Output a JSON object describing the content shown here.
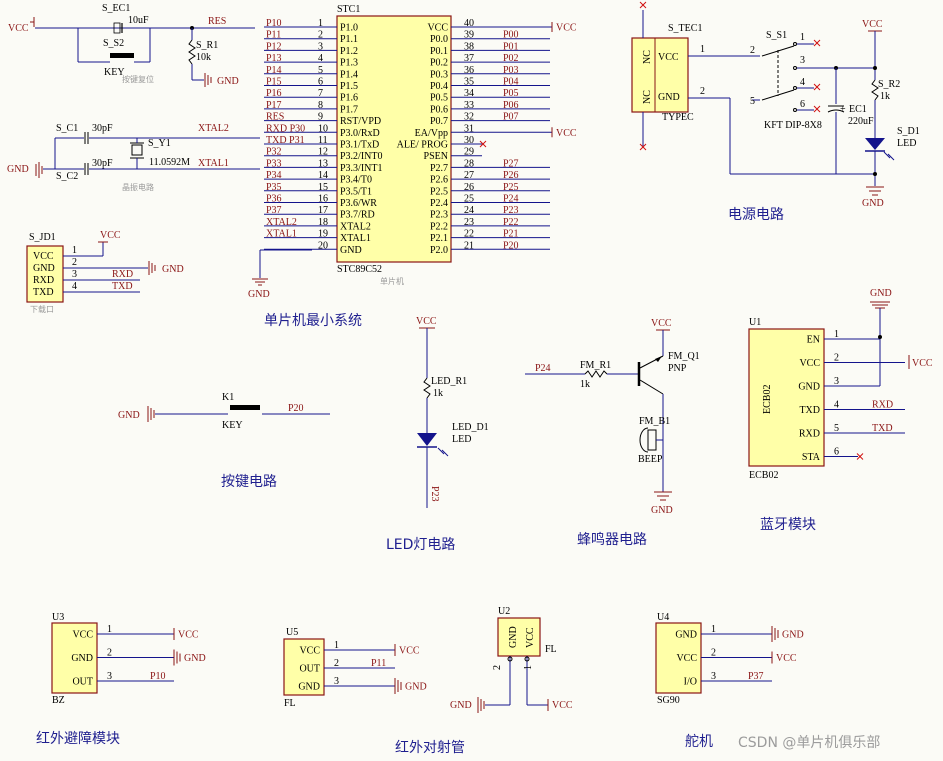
{
  "sections": {
    "mcu_title": "单片机最小系统",
    "power_title": "电源电路",
    "button_title": "按键电路",
    "led_title": "LED灯电路",
    "buzzer_title": "蜂鸣器电路",
    "bluetooth_title": "蓝牙模块",
    "ir_obstacle_title": "红外避障模块",
    "ir_beam_title": "红外对射管",
    "servo_title": "舵机"
  },
  "mcu": {
    "designator": "STC1",
    "part": "STC89C52",
    "caption": "单片机",
    "left_pins": [
      {
        "n": "1",
        "name": "P1.0",
        "net": "P10"
      },
      {
        "n": "2",
        "name": "P1.1",
        "net": "P11"
      },
      {
        "n": "3",
        "name": "P1.2",
        "net": "P12"
      },
      {
        "n": "4",
        "name": "P1.3",
        "net": "P13"
      },
      {
        "n": "5",
        "name": "P1.4",
        "net": "P14"
      },
      {
        "n": "6",
        "name": "P1.5",
        "net": "P15"
      },
      {
        "n": "7",
        "name": "P1.6",
        "net": "P16"
      },
      {
        "n": "8",
        "name": "P1.7",
        "net": "P17"
      },
      {
        "n": "9",
        "name": "RST/VPD",
        "net": "RES"
      },
      {
        "n": "10",
        "name": "P3.0/RxD",
        "net": "RXD P30"
      },
      {
        "n": "11",
        "name": "P3.1/TxD",
        "net": "TXD P31"
      },
      {
        "n": "12",
        "name": "P3.2/INT0",
        "net": "P32"
      },
      {
        "n": "13",
        "name": "P3.3/INT1",
        "net": "P33"
      },
      {
        "n": "14",
        "name": "P3.4/T0",
        "net": "P34"
      },
      {
        "n": "15",
        "name": "P3.5/T1",
        "net": "P35"
      },
      {
        "n": "16",
        "name": "P3.6/WR",
        "net": "P36"
      },
      {
        "n": "17",
        "name": "P3.7/RD",
        "net": "P37"
      },
      {
        "n": "18",
        "name": "XTAL2",
        "net": "XTAL2"
      },
      {
        "n": "19",
        "name": "XTAL1",
        "net": "XTAL1"
      },
      {
        "n": "20",
        "name": "GND",
        "net": ""
      }
    ],
    "right_pins": [
      {
        "n": "40",
        "name": "VCC",
        "net": "VCC"
      },
      {
        "n": "39",
        "name": "P0.0",
        "net": "P00"
      },
      {
        "n": "38",
        "name": "P0.1",
        "net": "P01"
      },
      {
        "n": "37",
        "name": "P0.2",
        "net": "P02"
      },
      {
        "n": "36",
        "name": "P0.3",
        "net": "P03"
      },
      {
        "n": "35",
        "name": "P0.4",
        "net": "P04"
      },
      {
        "n": "34",
        "name": "P0.5",
        "net": "P05"
      },
      {
        "n": "33",
        "name": "P0.6",
        "net": "P06"
      },
      {
        "n": "32",
        "name": "P0.7",
        "net": "P07"
      },
      {
        "n": "31",
        "name": "EA/Vpp",
        "net": "VCC"
      },
      {
        "n": "30",
        "name": "ALE/ PROG",
        "net": ""
      },
      {
        "n": "29",
        "name": "PSEN",
        "net": ""
      },
      {
        "n": "28",
        "name": "P2.7",
        "net": "P27"
      },
      {
        "n": "27",
        "name": "P2.6",
        "net": "P26"
      },
      {
        "n": "26",
        "name": "P2.5",
        "net": "P25"
      },
      {
        "n": "25",
        "name": "P2.4",
        "net": "P24"
      },
      {
        "n": "24",
        "name": "P2.3",
        "net": "P23"
      },
      {
        "n": "23",
        "name": "P2.2",
        "net": "P22"
      },
      {
        "n": "22",
        "name": "P2.1",
        "net": "P21"
      },
      {
        "n": "21",
        "name": "P2.0",
        "net": "P20"
      }
    ],
    "gnd": "GND"
  },
  "reset": {
    "vcc": "VCC",
    "cap": "S_EC1",
    "cap_value": "10uF",
    "switch": "S_S2",
    "switch_label": "KEY",
    "res": "S_R1",
    "res_value": "10k",
    "net": "RES",
    "gnd": "GND",
    "caption": "按键复位"
  },
  "crystal": {
    "c1": "S_C1",
    "c1_value": "30pF",
    "c2": "S_C2",
    "c2_value": "30pF",
    "xtal": "S_Y1",
    "freq": "11.0592M",
    "xtal2": "XTAL2",
    "xtal1": "XTAL1",
    "gnd": "GND",
    "caption": "晶振电路"
  },
  "download": {
    "designator": "S_JD1",
    "pins": [
      "VCC",
      "GND",
      "RXD",
      "TXD"
    ],
    "nums": [
      "1",
      "2",
      "3",
      "4"
    ],
    "vcc": "VCC",
    "gnd": "GND",
    "rxd": "RXD",
    "txd": "TXD",
    "caption": "下载口"
  },
  "power": {
    "jack": "S_TEC1",
    "jack_type": "TYPEC",
    "pin_vcc": "VCC",
    "pin_gnd": "GND",
    "nc": "NC",
    "pin1": "1",
    "pin2": "2",
    "switch": "S_S1",
    "switch_pins": [
      "1",
      "2",
      "3",
      "4",
      "5",
      "6"
    ],
    "switch_part": "KFT DIP-8X8",
    "cap": "EC1",
    "cap_value": "220uF",
    "res": "S_R2",
    "res_value": "1k",
    "led": "S_D1",
    "led_label": "LED",
    "vcc": "VCC",
    "gnd": "GND"
  },
  "button": {
    "gnd": "GND",
    "designator": "K1",
    "label": "KEY",
    "net": "P20"
  },
  "led": {
    "vcc": "VCC",
    "res": "LED_R1",
    "res_value": "1k",
    "led": "LED_D1",
    "led_label": "LED",
    "net": "P23"
  },
  "buzzer": {
    "vcc": "VCC",
    "net": "P24",
    "res": "FM_R1",
    "res_value": "1k",
    "transistor": "FM_Q1",
    "type": "PNP",
    "buzzer": "FM_B1",
    "buzzer_label": "BEEP",
    "gnd": "GND"
  },
  "bluetooth": {
    "designator": "U1",
    "part": "ECB02",
    "caption": "ECB02",
    "gnd": "GND",
    "vcc": "VCC",
    "pins": [
      {
        "name": "EN",
        "n": "1",
        "net": ""
      },
      {
        "name": "VCC",
        "n": "2",
        "net": "VCC"
      },
      {
        "name": "GND",
        "n": "3",
        "net": ""
      },
      {
        "name": "TXD",
        "n": "4",
        "net": "RXD"
      },
      {
        "name": "RXD",
        "n": "5",
        "net": "TXD"
      },
      {
        "name": "STA",
        "n": "6",
        "net": ""
      }
    ]
  },
  "ir_obstacle": {
    "designator": "U3",
    "caption": "BZ",
    "pins": [
      {
        "name": "VCC",
        "n": "1",
        "net": "VCC"
      },
      {
        "name": "GND",
        "n": "2",
        "net": "GND"
      },
      {
        "name": "OUT",
        "n": "3",
        "net": "P10"
      }
    ]
  },
  "u5": {
    "designator": "U5",
    "caption": "FL",
    "pins": [
      {
        "name": "VCC",
        "n": "1",
        "net": "VCC"
      },
      {
        "name": "OUT",
        "n": "2",
        "net": "P11"
      },
      {
        "name": "GND",
        "n": "3",
        "net": "GND"
      }
    ]
  },
  "u2": {
    "designator": "U2",
    "caption": "FL",
    "pin_gnd": "GND",
    "pin_vcc": "VCC",
    "n_gnd": "2",
    "n_vcc": "1",
    "gnd": "GND",
    "vcc": "VCC"
  },
  "servo": {
    "designator": "U4",
    "caption": "SG90",
    "pins": [
      {
        "name": "GND",
        "n": "1",
        "net": "GND"
      },
      {
        "name": "VCC",
        "n": "2",
        "net": "VCC"
      },
      {
        "name": "I/O",
        "n": "3",
        "net": "P37"
      }
    ]
  },
  "watermark": "CSDN @单片机俱乐部"
}
